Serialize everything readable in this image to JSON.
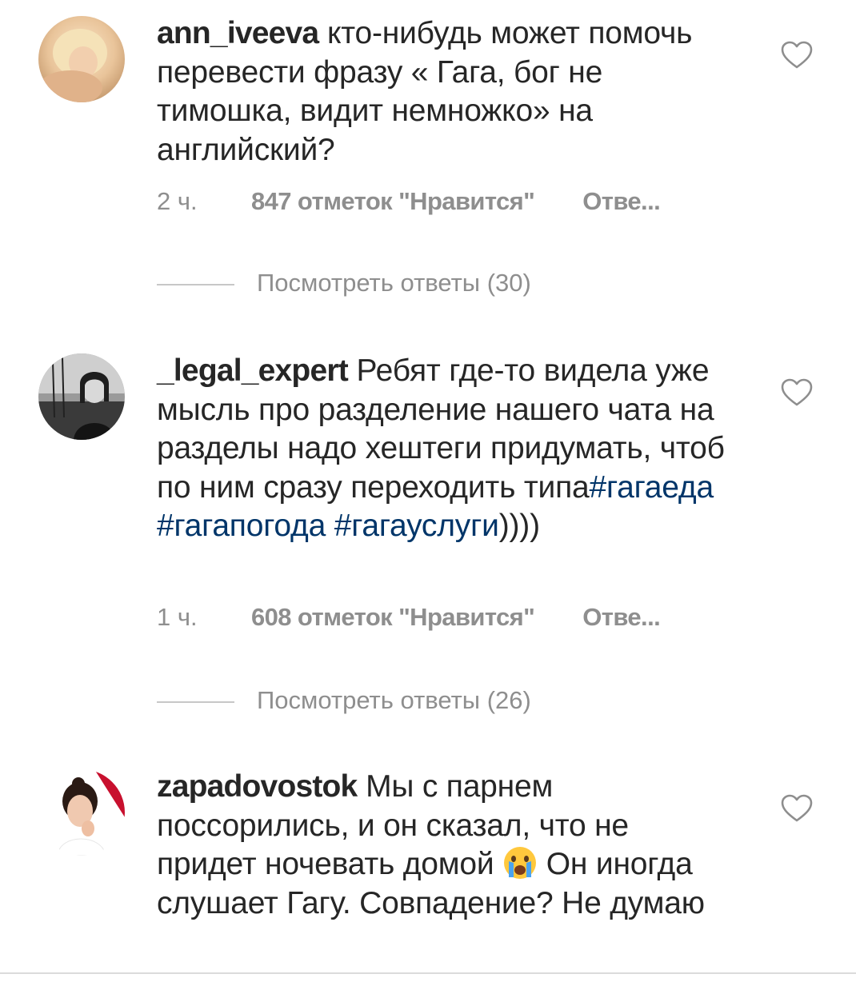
{
  "comments": [
    {
      "username": "ann_iveeva",
      "text": " кто-нибудь может помочь перевести фразу « Гага, бог не тимошка, видит немножко» на английский?",
      "time": "2 ч.",
      "likes": "847 отметок \"Нравится\"",
      "reply": "Отве...",
      "view_replies": "Посмотреть ответы (30)"
    },
    {
      "username": "_legal_expert",
      "text_before": " Ребят где-то видела уже мысль про разделение нашего чата на разделы  надо хештеги придумать, чтоб по ним сразу переходить типа",
      "hashtag1": "#гагаеда",
      "hashtag2": "#гагапогода",
      "space": " ",
      "hashtag3": "#гагауслуги",
      "text_after": "))))",
      "time": "1 ч.",
      "likes": "608 отметок \"Нравится\"",
      "reply": "Отве...",
      "view_replies": "Посмотреть ответы (26)"
    },
    {
      "username": "zapadovostok",
      "text_before": " Мы с парнем поссорились, и он сказал, что не придет ночевать домой ",
      "emoji": "crying-face-emoji",
      "text_after": " Он иногда слушает Гагу. Совпадение? Не думаю"
    }
  ],
  "icons": {
    "like": "heart-outline-icon"
  },
  "colors": {
    "text": "#262626",
    "secondary": "#8e8e8e",
    "hashtag": "#003569"
  }
}
